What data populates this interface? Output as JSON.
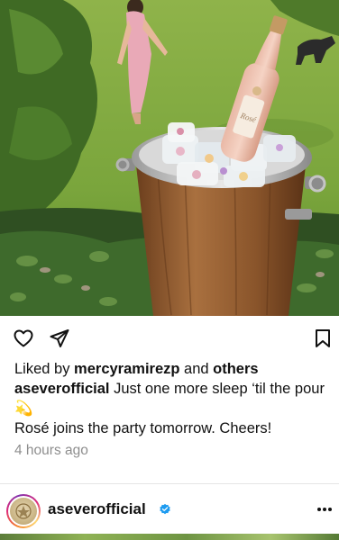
{
  "post": {
    "image_alt_subject": "rose-bottle-in-ice-bucket",
    "liked_prefix": "Liked by ",
    "liked_user": "mercyramirezp",
    "liked_joiner": " and ",
    "liked_others": "others",
    "author": "aseverofficial",
    "caption_line1": " Just one more sleep ‘til the pour 💫",
    "caption_line2": "Rosé joins the party tomorrow. Cheers!",
    "time": "4 hours ago"
  },
  "icons": {
    "like": "heart-icon",
    "share": "paper-plane-icon",
    "save": "bookmark-icon",
    "verified": "verified-badge-icon",
    "more": "more-dots-icon"
  },
  "next_post": {
    "username": "aseverofficial",
    "more_label": "···"
  },
  "colors": {
    "verified": "#1d9bf0",
    "muted_text": "#8e8e8e"
  }
}
